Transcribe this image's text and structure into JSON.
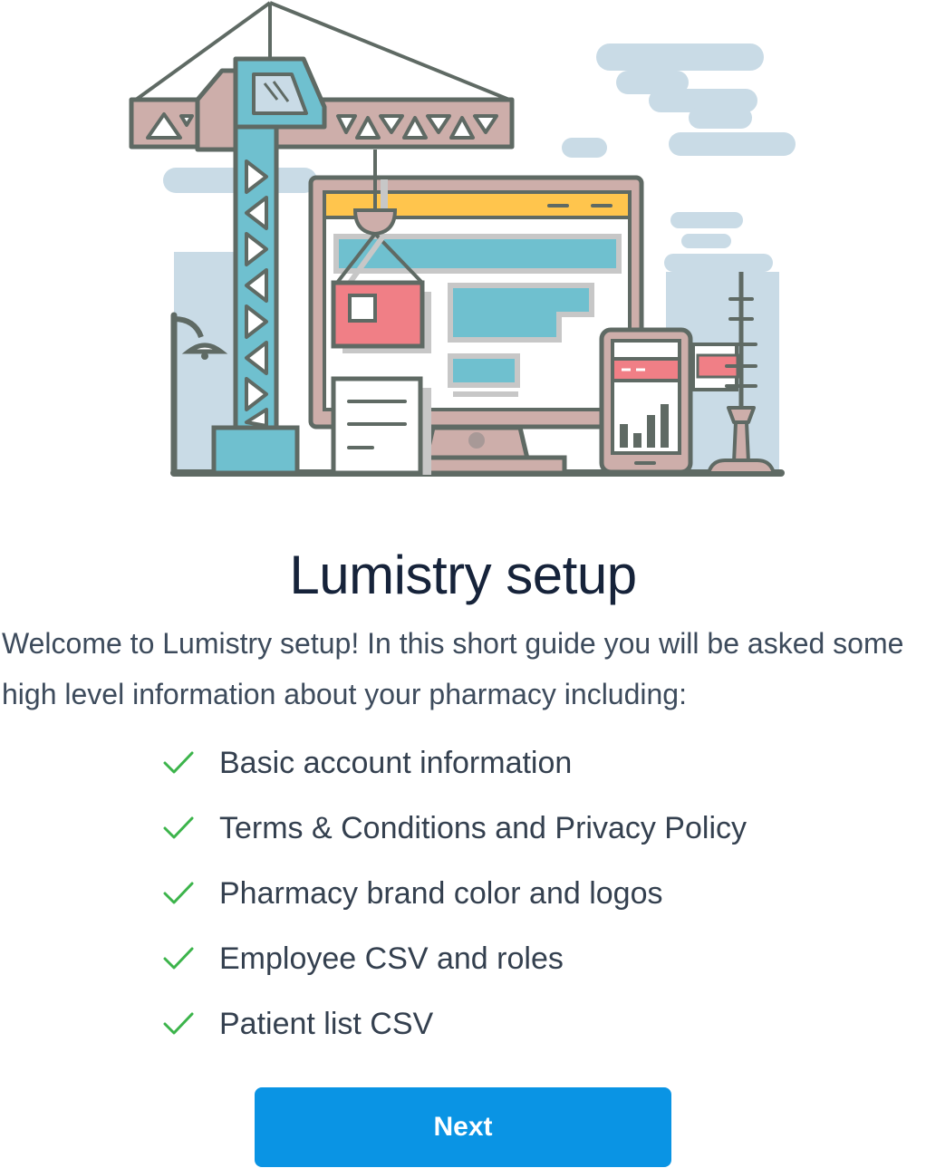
{
  "header": {
    "title": "Lumistry setup",
    "illustration_icon": "construction-crane-computer-icon"
  },
  "intro": {
    "text": "Welcome to Lumistry setup! In this short guide you will be asked some high level information about your pharmacy including:"
  },
  "checklist": {
    "icon": "checkmark-icon",
    "check_color": "#3cb44b",
    "items": [
      {
        "label": "Basic account information"
      },
      {
        "label": "Terms & Conditions and Privacy Policy"
      },
      {
        "label": "Pharmacy brand color and logos"
      },
      {
        "label": "Employee CSV and roles"
      },
      {
        "label": "Patient list CSV"
      }
    ]
  },
  "actions": {
    "next_label": "Next",
    "button_color": "#0a94e4"
  }
}
